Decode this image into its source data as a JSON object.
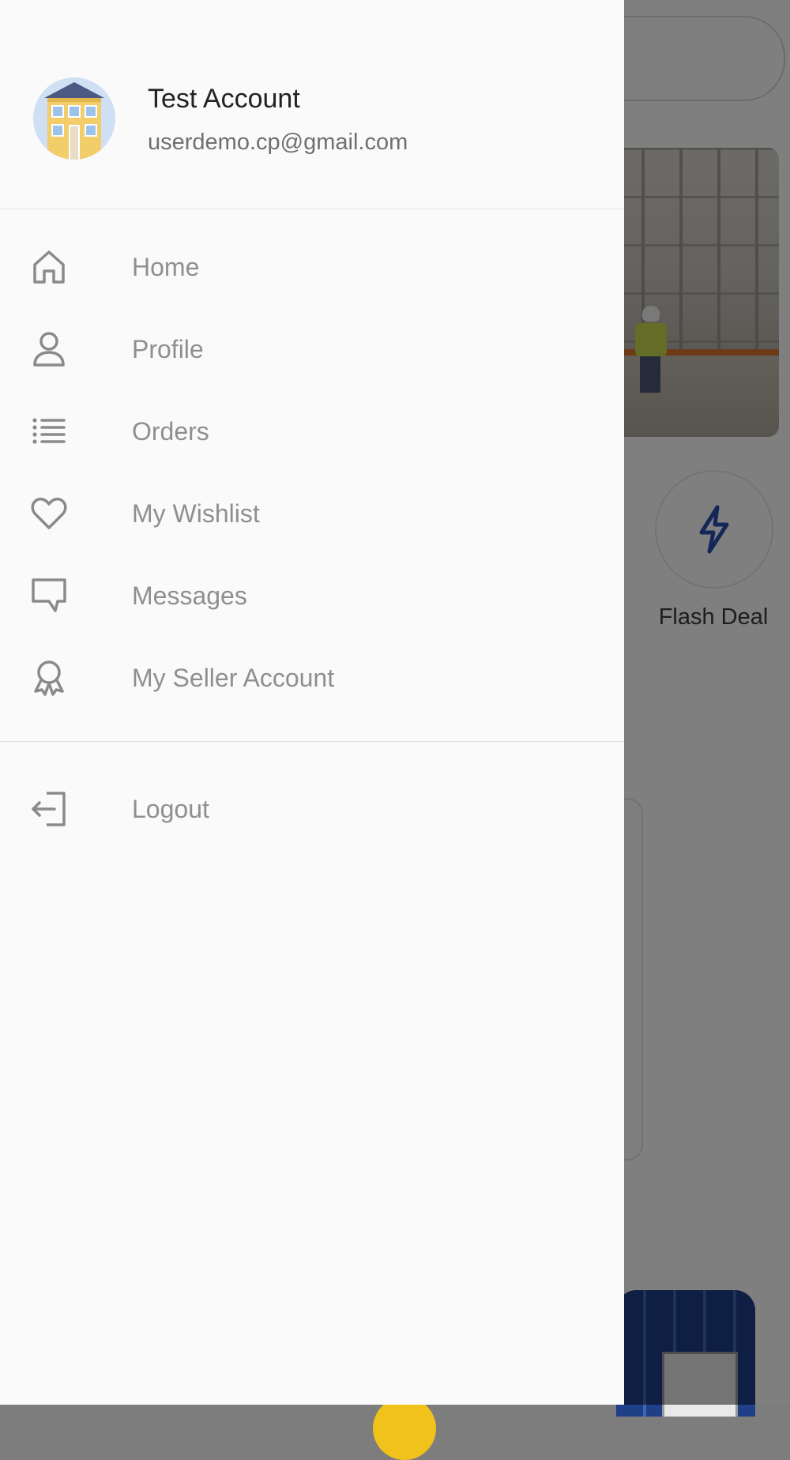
{
  "user": {
    "name": "Test Account",
    "email": "userdemo.cp@gmail.com"
  },
  "menu": {
    "items": [
      {
        "label": "Home",
        "icon": "home-icon"
      },
      {
        "label": "Profile",
        "icon": "user-icon"
      },
      {
        "label": "Orders",
        "icon": "list-icon"
      },
      {
        "label": "My Wishlist",
        "icon": "heart-icon"
      },
      {
        "label": "Messages",
        "icon": "message-icon"
      },
      {
        "label": "My Seller Account",
        "icon": "award-icon"
      }
    ],
    "logout": {
      "label": "Logout",
      "icon": "logout-icon"
    }
  },
  "background": {
    "flash_deal_label": "Flash Deal"
  },
  "colors": {
    "accent_blue": "#2b4fb3",
    "drawer_bg": "#fafafa",
    "menu_text": "#8f8f8f",
    "overlay": "rgba(0,0,0,0.5)"
  }
}
